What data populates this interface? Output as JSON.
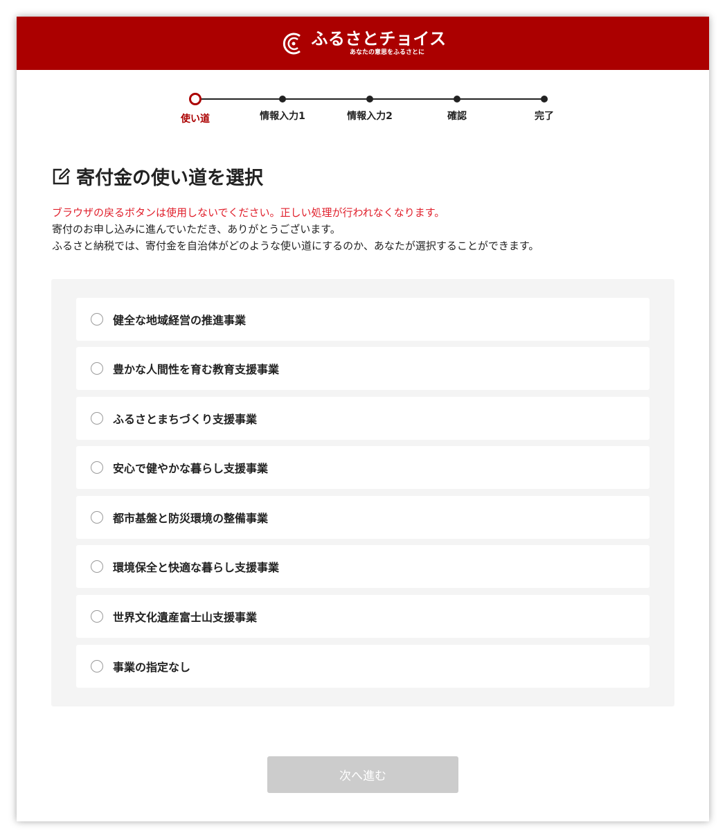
{
  "header": {
    "brand_name": "ふるさとチョイス",
    "tagline": "あなたの意思をふるさとに",
    "background_color": "#ab0000"
  },
  "stepper": {
    "current_index": 0,
    "steps": [
      {
        "label": "使い道"
      },
      {
        "label": "情報入力1"
      },
      {
        "label": "情報入力2"
      },
      {
        "label": "確認"
      },
      {
        "label": "完了"
      }
    ]
  },
  "page": {
    "title": "寄付金の使い道を選択",
    "warning": "ブラウザの戻るボタンは使用しないでください。正しい処理が行われなくなります。",
    "intro_line1": "寄付のお申し込みに進んでいただき、ありがとうございます。",
    "intro_line2": "ふるさと納税では、寄付金を自治体がどのような使い道にするのか、あなたが選択することができます。"
  },
  "options": [
    {
      "label": "健全な地域経営の推進事業",
      "selected": false
    },
    {
      "label": "豊かな人間性を育む教育支援事業",
      "selected": false
    },
    {
      "label": "ふるさとまちづくり支援事業",
      "selected": false
    },
    {
      "label": "安心で健やかな暮らし支援事業",
      "selected": false
    },
    {
      "label": "都市基盤と防災環境の整備事業",
      "selected": false
    },
    {
      "label": "環境保全と快適な暮らし支援事業",
      "selected": false
    },
    {
      "label": "世界文化遺産富士山支援事業",
      "selected": false
    },
    {
      "label": "事業の指定なし",
      "selected": false
    }
  ],
  "next_button": {
    "label": "次へ進む",
    "disabled": true
  },
  "colors": {
    "accent": "#ab0000",
    "warning_text": "#e0202c",
    "disabled_button": "#cccccc"
  }
}
